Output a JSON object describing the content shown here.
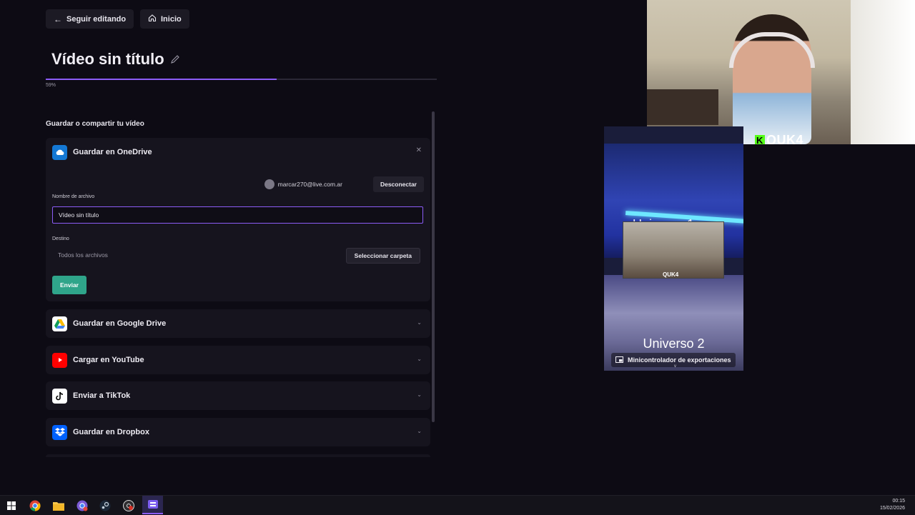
{
  "header": {
    "back_label": "Seguir editando",
    "home_label": "Inicio"
  },
  "video": {
    "title": "Vídeo sin título",
    "progress_percent": 59,
    "progress_label": "59%"
  },
  "section": {
    "label": "Guardar o compartir tu vídeo"
  },
  "onedrive": {
    "title": "Guardar en OneDrive",
    "account_email": "marcar270@live.com.ar",
    "disconnect_label": "Desconectar",
    "filename_label": "Nombre de archivo",
    "filename_value": "Vídeo sin título",
    "destination_label": "Destino",
    "destination_value": "Todos los archivos",
    "select_folder_label": "Seleccionar carpeta",
    "send_label": "Enviar"
  },
  "services": [
    {
      "label": "Guardar en Google Drive",
      "icon": "google-drive-icon"
    },
    {
      "label": "Cargar en YouTube",
      "icon": "youtube-icon"
    },
    {
      "label": "Enviar a TikTok",
      "icon": "tiktok-icon"
    },
    {
      "label": "Guardar en Dropbox",
      "icon": "dropbox-icon"
    }
  ],
  "webcam": {
    "tag": "QUK4"
  },
  "preview": {
    "overlay_text_1": "Universo 1",
    "overlay_text_2": "Universo 2",
    "inner_tag": "QUK4",
    "mini_controller_label": "Minicontrolador de exportaciones"
  },
  "taskbar": {
    "time": "00:15",
    "date": "15/02/2026"
  },
  "colors": {
    "accent": "#8b5cf6",
    "send": "#2fa58a",
    "background": "#0d0b14"
  }
}
